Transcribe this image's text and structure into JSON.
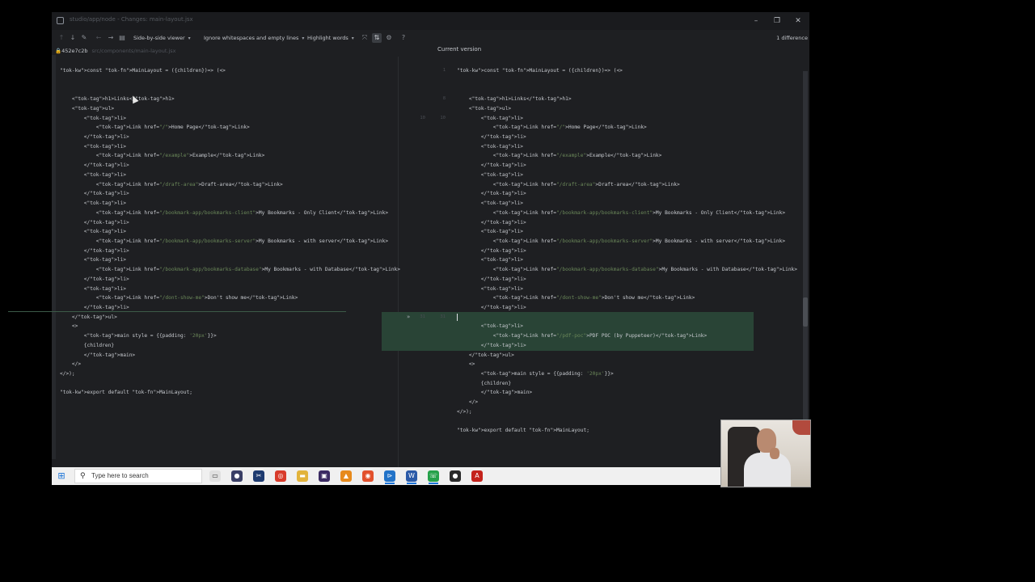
{
  "window": {
    "title": "studio/app/node - Changes: main-layout.jsx",
    "minimize": "–",
    "maximize": "❐",
    "close": "✕"
  },
  "toolbar": {
    "viewer_mode": "Side-by-side viewer",
    "whitespace_mode": "Ignore whitespaces and empty lines",
    "highlight_mode": "Highlight words",
    "difference_count": "1 difference",
    "icons": [
      "arrow-up-icon",
      "arrow-down-icon",
      "edit-icon",
      "back-icon",
      "forward-icon",
      "file-icon",
      "collapse-icon",
      "sync-scroll-icon",
      "settings-icon",
      "help-icon"
    ]
  },
  "left_header": {
    "revision": "452e7c2b",
    "path": "src/components/main-layout.jsx"
  },
  "right_header": {
    "label": "Current version"
  },
  "left_code": [
    {
      "text": "const MainLayout = ({children})=> (<>"
    },
    {
      "text": ""
    },
    {
      "text": ""
    },
    {
      "text": "    <h1>Links</h1>"
    },
    {
      "text": "    <ul>"
    },
    {
      "text": "        <li>"
    },
    {
      "text": "            <Link href=\"/\">Home Page</Link>"
    },
    {
      "text": "        </li>"
    },
    {
      "text": "        <li>"
    },
    {
      "text": "            <Link href=\"/example\">Example</Link>"
    },
    {
      "text": "        </li>"
    },
    {
      "text": "        <li>"
    },
    {
      "text": "            <Link href=\"/draft-area\">Draft-area</Link>"
    },
    {
      "text": "        </li>"
    },
    {
      "text": "        <li>"
    },
    {
      "text": "            <Link href=\"/bookmark-app/bookmarks-client\">My Bookmarks - Only Client</Link>"
    },
    {
      "text": "        </li>"
    },
    {
      "text": "        <li>"
    },
    {
      "text": "            <Link href=\"/bookmark-app/bookmarks-server\">My Bookmarks - with server</Link>"
    },
    {
      "text": "        </li>"
    },
    {
      "text": "        <li>"
    },
    {
      "text": "            <Link href=\"/bookmark-app/bookmarks-database\">My Bookmarks - with Database</Link>"
    },
    {
      "text": "        </li>"
    },
    {
      "text": "        <li>"
    },
    {
      "text": "            <Link href=\"/dont-show-me\">Don't show me</Link>"
    },
    {
      "text": "        </li>"
    },
    {
      "text": "    </ul>"
    },
    {
      "text": "    <>"
    },
    {
      "text": "        <main style = {{padding: '20px'}}>"
    },
    {
      "text": "        {children}"
    },
    {
      "text": "        </main>"
    },
    {
      "text": "    </>"
    },
    {
      "text": "</>);"
    },
    {
      "text": ""
    },
    {
      "text": "export default MainLayout;"
    }
  ],
  "right_code": [
    {
      "ln_left": "",
      "ln_right": "1",
      "text": "const MainLayout = ({children})=> (<>"
    },
    {
      "ln_left": "",
      "ln_right": "",
      "text": ""
    },
    {
      "ln_left": "",
      "ln_right": "",
      "text": ""
    },
    {
      "ln_left": "",
      "ln_right": "8",
      "text": "    <h1>Links</h1>"
    },
    {
      "ln_left": "",
      "ln_right": "",
      "text": "    <ul>"
    },
    {
      "ln_left": "10",
      "ln_right": "10",
      "text": "        <li>"
    },
    {
      "ln_left": "",
      "ln_right": "",
      "text": "            <Link href=\"/\">Home Page</Link>"
    },
    {
      "ln_left": "",
      "ln_right": "",
      "text": "        </li>"
    },
    {
      "ln_left": "",
      "ln_right": "",
      "text": "        <li>"
    },
    {
      "ln_left": "",
      "ln_right": "",
      "text": "            <Link href=\"/example\">Example</Link>"
    },
    {
      "ln_left": "",
      "ln_right": "",
      "text": "        </li>"
    },
    {
      "ln_left": "",
      "ln_right": "",
      "text": "        <li>"
    },
    {
      "ln_left": "",
      "ln_right": "",
      "text": "            <Link href=\"/draft-area\">Draft-area</Link>"
    },
    {
      "ln_left": "",
      "ln_right": "",
      "text": "        </li>"
    },
    {
      "ln_left": "",
      "ln_right": "",
      "text": "        <li>"
    },
    {
      "ln_left": "",
      "ln_right": "",
      "text": "            <Link href=\"/bookmark-app/bookmarks-client\">My Bookmarks - Only Client</Link>"
    },
    {
      "ln_left": "",
      "ln_right": "",
      "text": "        </li>"
    },
    {
      "ln_left": "",
      "ln_right": "",
      "text": "        <li>"
    },
    {
      "ln_left": "",
      "ln_right": "",
      "text": "            <Link href=\"/bookmark-app/bookmarks-server\">My Bookmarks - with server</Link>"
    },
    {
      "ln_left": "",
      "ln_right": "",
      "text": "        </li>"
    },
    {
      "ln_left": "",
      "ln_right": "",
      "text": "        <li>"
    },
    {
      "ln_left": "",
      "ln_right": "",
      "text": "            <Link href=\"/bookmark-app/bookmarks-database\">My Bookmarks - with Database</Link>"
    },
    {
      "ln_left": "",
      "ln_right": "",
      "text": "        </li>"
    },
    {
      "ln_left": "",
      "ln_right": "",
      "text": "        <li>"
    },
    {
      "ln_left": "",
      "ln_right": "",
      "text": "            <Link href=\"/dont-show-me\">Don't show me</Link>"
    },
    {
      "ln_left": "",
      "ln_right": "",
      "text": "        </li>"
    },
    {
      "ln_left": "31",
      "ln_right": "31",
      "text": ""
    },
    {
      "ln_left": "",
      "ln_right": "",
      "text": "        <li>"
    },
    {
      "ln_left": "",
      "ln_right": "",
      "text": "            <Link href=\"/pdf-poc\">PDF POC (by Puppeteer)</Link>"
    },
    {
      "ln_left": "",
      "ln_right": "",
      "text": "        </li>"
    },
    {
      "ln_left": "",
      "ln_right": "",
      "text": "    </ul>"
    },
    {
      "ln_left": "",
      "ln_right": "",
      "text": "    <>"
    },
    {
      "ln_left": "",
      "ln_right": "",
      "text": "        <main style = {{padding: '20px'}}>"
    },
    {
      "ln_left": "",
      "ln_right": "",
      "text": "        {children}"
    },
    {
      "ln_left": "",
      "ln_right": "",
      "text": "        </main>"
    },
    {
      "ln_left": "",
      "ln_right": "",
      "text": "    </>"
    },
    {
      "ln_left": "",
      "ln_right": "",
      "text": "</>);"
    },
    {
      "ln_left": "",
      "ln_right": "",
      "text": ""
    },
    {
      "ln_left": "",
      "ln_right": "",
      "text": "export default MainLayout;"
    }
  ],
  "merge_arrow": "»",
  "taskbar": {
    "search_placeholder": "Type here to search",
    "apps": [
      "task-view-icon",
      "media-icon",
      "snip-icon",
      "chrome-icon",
      "folder-icon",
      "app-icon",
      "vlc-icon",
      "firefox-icon",
      "vscode-icon",
      "word-icon",
      "whatsapp-icon",
      "record-icon",
      "acrobat-icon"
    ],
    "tray": "⌃ 🔊 ⊟"
  },
  "colors": {
    "background": "#1e1f22",
    "added_block": "#294436",
    "keyword": "#cc7832",
    "function": "#56a8f5",
    "tag": "#e8bf6a",
    "string": "#6a8759",
    "taskbar": "#f0f0f0"
  }
}
